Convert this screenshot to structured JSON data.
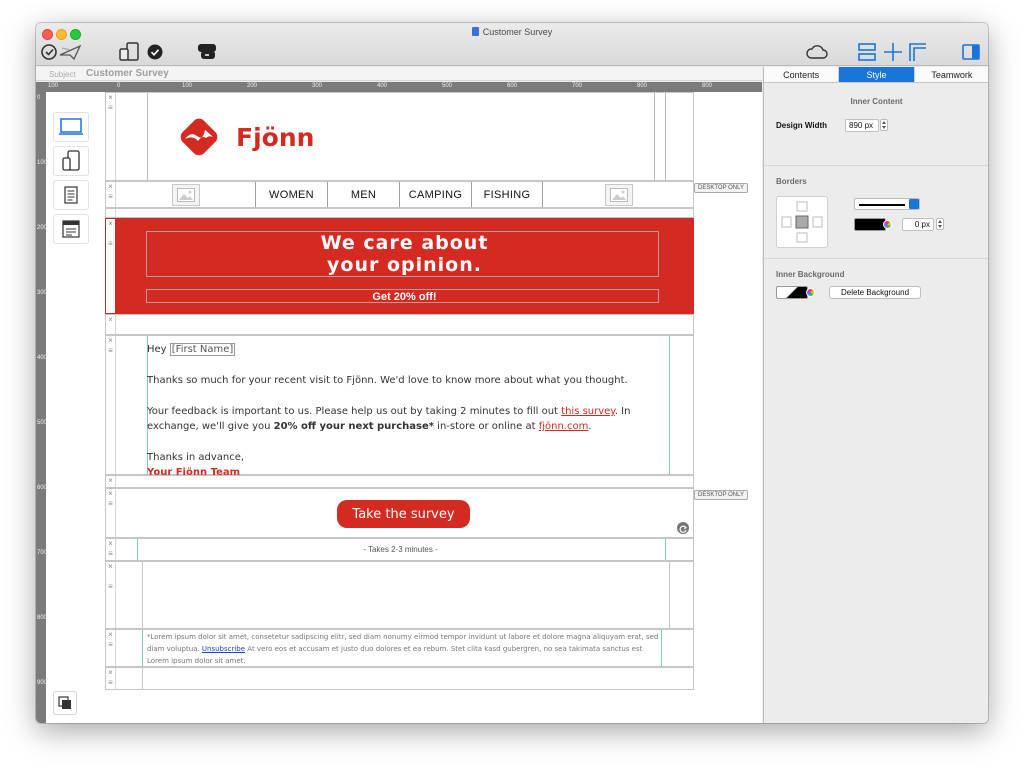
{
  "window": {
    "title": "Customer Survey"
  },
  "subject": {
    "label": "Subject",
    "value": "Customer Survey"
  },
  "rulers": {
    "h": [
      "100",
      "0",
      "100",
      "200",
      "300",
      "400",
      "500",
      "600",
      "700",
      "800",
      "800"
    ],
    "v": [
      "0",
      "100",
      "200",
      "300",
      "400",
      "500",
      "600",
      "700",
      "800",
      "900"
    ]
  },
  "email": {
    "brand": "Fjönn",
    "nav": [
      "WOMEN",
      "MEN",
      "CAMPING",
      "FISHING"
    ],
    "desktop_only": "DESKTOP ONLY",
    "hero_title_1": "We care about",
    "hero_title_2": "your opinion.",
    "hero_sub": "Get 20% off!",
    "greeting": "Hey",
    "merge_tag": "[First Name]",
    "para1": "Thanks so much for your recent visit to Fjönn. We'd love to know more about what you thought.",
    "para2_a": "Your feedback is important to us. Please help us out by taking 2 minutes to fill out ",
    "para2_link": "this survey",
    "para2_b": ". In exchange, we'll give you ",
    "para2_bold": "20% off your next purchase*",
    "para2_c": " in-store or online at ",
    "para2_link2": "fjönn.com",
    "para2_end": ".",
    "thanks": "Thanks in advance,",
    "signature": "Your Fjönn Team",
    "cta": "Take the survey",
    "takes": "- Takes 2-3 minutes -",
    "legal_a": "*Lorem ipsum dolor sit amet, consetetur sadipscing elitr, sed diam nonumy eirmod tempor invidunt ut labore et dolore magna aliquyam erat, sed diam voluptua. ",
    "legal_link": "Unsubscribe",
    "legal_b": " At vero eos et accusam et justo duo dolores et ea rebum. Stet clita kasd gubergren, no sea takimata sanctus est Lorem ipsum dolor sit amet."
  },
  "panel": {
    "tabs": [
      "Contents",
      "Style",
      "Teamwork"
    ],
    "active_tab": "Style",
    "inner_content": "Inner Content",
    "design_width_label": "Design Width",
    "design_width_value": "890 px",
    "borders": "Borders",
    "border_width": "0 px",
    "inner_background": "Inner Background",
    "delete_background": "Delete Background"
  },
  "colors": {
    "brand_red": "#d32a22",
    "accent_blue": "#1a74d9"
  },
  "icons": [
    "send-test-icon",
    "preview-devices-icon",
    "checkmark-icon",
    "comment-icon",
    "cloud-icon",
    "layout-toggle-icon",
    "sidebar-toggle-icon"
  ]
}
